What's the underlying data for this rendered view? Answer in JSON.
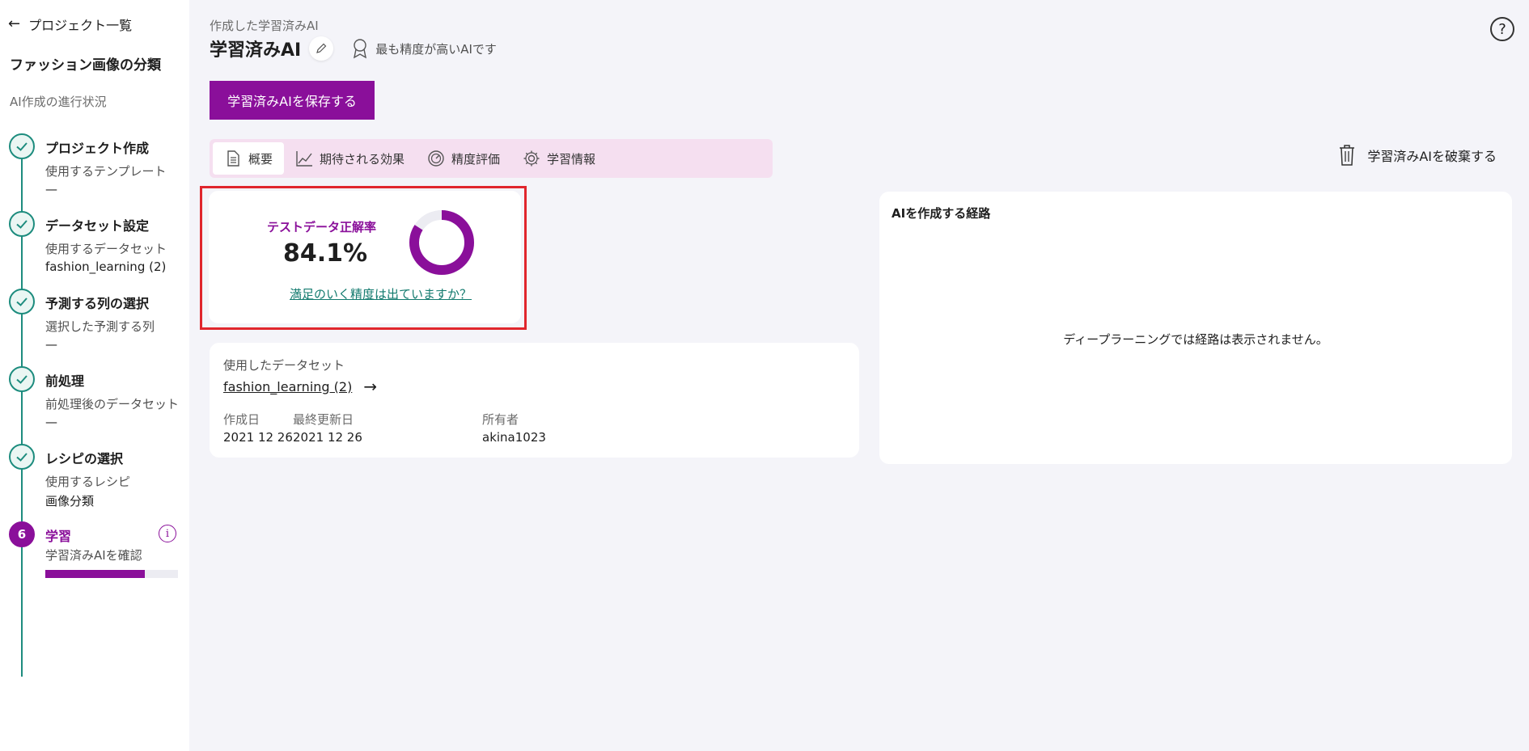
{
  "sidebar": {
    "back_label": "プロジェクト一覧",
    "project_name": "ファッション画像の分類",
    "progress_title": "AI作成の進行状況",
    "steps": [
      {
        "title": "プロジェクト作成",
        "sub": "使用するテンプレート",
        "value": "—"
      },
      {
        "title": "データセット設定",
        "sub": "使用するデータセット",
        "value": "fashion_learning (2)"
      },
      {
        "title": "予測する列の選択",
        "sub": "選択した予測する列",
        "value": "—"
      },
      {
        "title": "前処理",
        "sub": "前処理後のデータセット",
        "value": "—"
      },
      {
        "title": "レシピの選択",
        "sub": "使用するレシピ",
        "value": "画像分類"
      },
      {
        "number": "6",
        "title": "学習",
        "sub": "学習済みAIを確認",
        "progress": 0.75
      }
    ]
  },
  "header": {
    "subtitle": "作成した学習済みAI",
    "title": "学習済みAI",
    "best_badge": "最も精度が高いAIです",
    "help": "?"
  },
  "save_button": "学習済みAIを保存する",
  "tabs": [
    {
      "label": "概要",
      "icon": "document-icon"
    },
    {
      "label": "期待される効果",
      "icon": "trend-chart-icon"
    },
    {
      "label": "精度評価",
      "icon": "gauge-icon"
    },
    {
      "label": "学習情報",
      "icon": "gear-icon"
    }
  ],
  "discard_label": "学習済みAIを破棄する",
  "accuracy": {
    "label": "テストデータ正解率",
    "value": "84.1%",
    "fraction": 0.841,
    "link": "満足のいく精度は出ていますか？",
    "color": "#8a0f9a"
  },
  "dataset": {
    "label": "使用したデータセット",
    "name": "fashion_learning (2)",
    "created_label": "作成日",
    "created": "2021 12 26",
    "updated_label": "最終更新日",
    "updated": "2021 12 26",
    "owner_label": "所有者",
    "owner": "akina1023"
  },
  "route": {
    "title": "AIを作成する経路",
    "message": "ディープラーニングでは経路は表示されません。"
  },
  "colors": {
    "accent": "#8a0f9a",
    "teal": "#1d8c7e",
    "tab_bg": "#f5dff0",
    "highlight": "#e0262d"
  }
}
